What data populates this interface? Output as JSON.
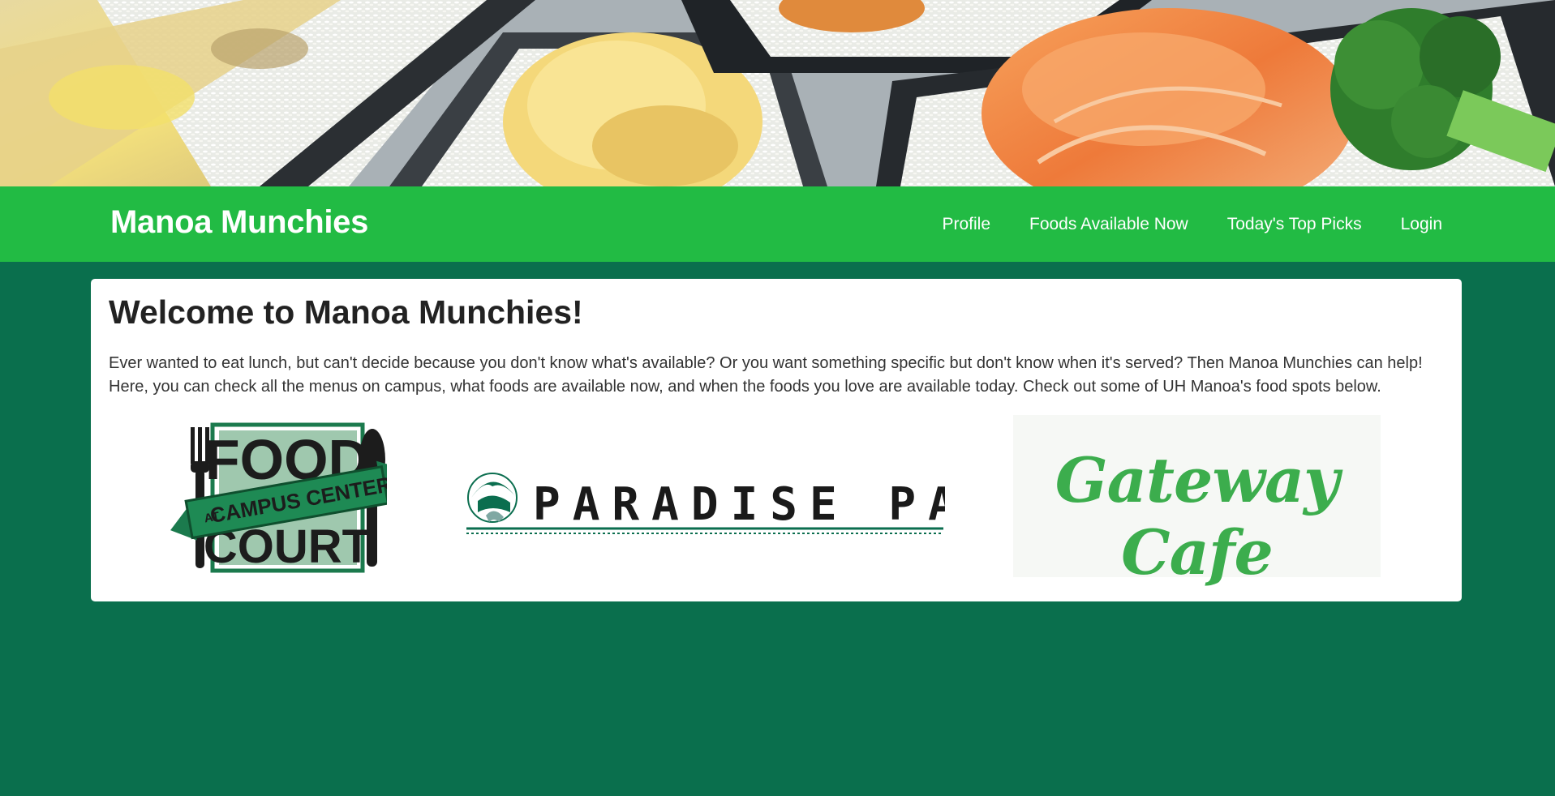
{
  "hero": {
    "image": "takeout-food-bento-photo"
  },
  "navbar": {
    "brand": "Manoa Munchies",
    "links": [
      {
        "label": "Profile"
      },
      {
        "label": "Foods Available Now"
      },
      {
        "label": "Today's Top Picks"
      },
      {
        "label": "Login"
      }
    ]
  },
  "main": {
    "title": "Welcome to Manoa Munchies!",
    "description": "Ever wanted to eat lunch, but can't decide because you don't know what's available? Or you want something specific but don't know when it's served? Then Manoa Munchies can help! Here, you can check all the menus on campus, what foods are available now, and when the foods you love are available today. Check out some of UH Manoa's food spots below.",
    "logos": {
      "food_court": {
        "line1": "FOOD",
        "banner": "CAMPUS CENTER",
        "banner_prefix": "AT",
        "line2": "COURT"
      },
      "paradise_palms": {
        "text": "PARADISE PALMS"
      },
      "gateway_cafe": {
        "text": "Gateway Cafe"
      }
    }
  },
  "colors": {
    "page_bg": "#0a6f4d",
    "navbar_bg": "#22bb44",
    "card_bg": "#ffffff",
    "logo_green": "#3cad4d",
    "palms_green": "#0b6e4f"
  }
}
